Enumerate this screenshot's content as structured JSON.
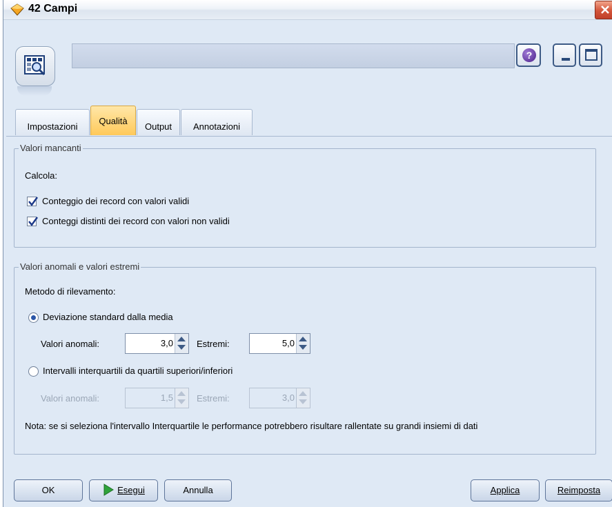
{
  "window": {
    "title": "42 Campi"
  },
  "tabs": [
    {
      "label": "Impostazioni"
    },
    {
      "label": "Qualità"
    },
    {
      "label": "Output"
    },
    {
      "label": "Annotazioni"
    }
  ],
  "missing": {
    "title": "Valori mancanti",
    "calc_label": "Calcola:",
    "checks": [
      {
        "label": "Conteggio dei record con valori validi",
        "checked": true
      },
      {
        "label": "Conteggi distinti dei record con valori non validi",
        "checked": true
      }
    ]
  },
  "outliers": {
    "title": "Valori anomali e valori estremi",
    "method_label": "Metodo di rilevamento:",
    "option1": {
      "label": "Deviazione standard dalla media",
      "selected": true,
      "outlier_label": "Valori anomali:",
      "outlier_value": "3,0",
      "extreme_label": "Estremi:",
      "extreme_value": "5,0"
    },
    "option2": {
      "label": "Intervalli interquartili da quartili superiori/inferiori",
      "selected": false,
      "outlier_label": "Valori anomali:",
      "outlier_value": "1,5",
      "extreme_label": "Estremi:",
      "extreme_value": "3,0"
    },
    "note": "Nota: se si seleziona l'intervallo Interquartile le performance potrebbero risultare rallentate su grandi insiemi di dati"
  },
  "buttons": {
    "ok": "OK",
    "run": "Esegui",
    "cancel": "Annulla",
    "apply": "Applica",
    "reset": "Reimposta"
  },
  "icons": {
    "title_icon": "diamond-node-icon",
    "node_icon": "data-audit-icon",
    "help_icon": "help-icon",
    "close_icon": "close-icon",
    "minimize_icon": "minimize-icon",
    "maximize_icon": "maximize-icon",
    "run_icon": "play-icon",
    "checkbox_icon": "checkmark-icon"
  }
}
